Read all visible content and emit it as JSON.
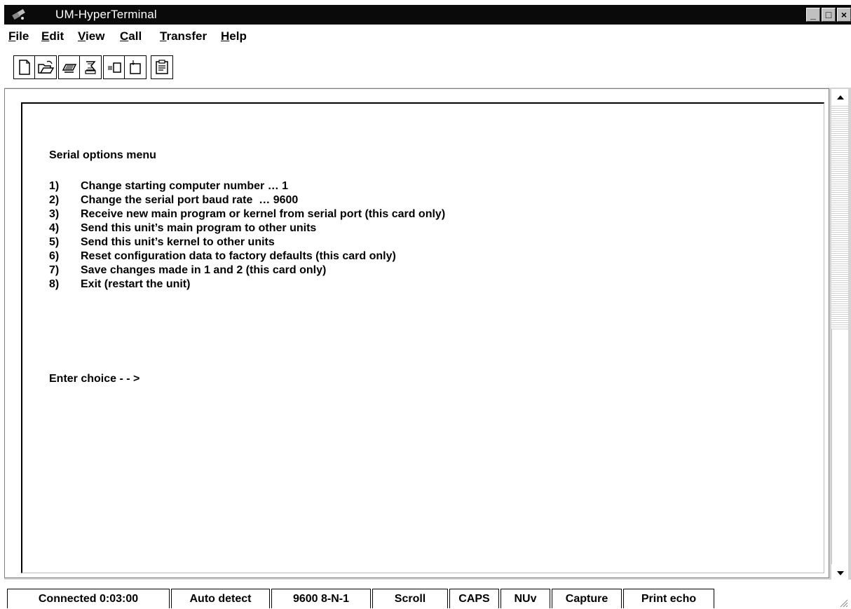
{
  "window": {
    "title": "UM-HyperTerminal",
    "controls": [
      "_",
      "□",
      "×"
    ]
  },
  "menu": {
    "items": [
      {
        "accel": "F",
        "rest": "ile"
      },
      {
        "accel": "E",
        "rest": "dit"
      },
      {
        "accel": "V",
        "rest": "iew"
      },
      {
        "accel": "C",
        "rest": "all"
      },
      {
        "accel": "T",
        "rest": "ransfer"
      },
      {
        "accel": "H",
        "rest": "elp"
      }
    ]
  },
  "toolbar": {
    "icons": [
      "new-icon",
      "open-icon",
      "connect-icon",
      "disconnect-icon",
      "send-icon",
      "receive-icon",
      "properties-icon"
    ]
  },
  "terminal": {
    "title": "Serial options menu",
    "options": [
      {
        "num": "1)",
        "text": "Change starting computer number … 1"
      },
      {
        "num": "2)",
        "text": "Change the serial port baud rate  … 9600"
      },
      {
        "num": "3)",
        "text": "Receive new main program or kernel from serial port (this card only)"
      },
      {
        "num": "4)",
        "text": "Send this unit’s main program to other units"
      },
      {
        "num": "5)",
        "text": "Send this unit’s kernel to other units"
      },
      {
        "num": "6)",
        "text": "Reset configuration data to factory defaults (this card only)"
      },
      {
        "num": "7)",
        "text": "Save changes made in 1 and 2 (this card only)"
      },
      {
        "num": "8)",
        "text": "Exit (restart the unit)"
      }
    ],
    "prompt": "Enter choice - - >"
  },
  "status": {
    "connected": "Connected 0:03:00",
    "detect": "Auto detect",
    "settings": "9600 8-N-1",
    "scroll": "Scroll",
    "caps": "CAPS",
    "num": "NUv",
    "capture": "Capture",
    "print_echo": "Print echo"
  },
  "colors": {
    "titlebar": "#0a0a0a",
    "background": "#ffffff",
    "frame": "#d4d4d4"
  }
}
